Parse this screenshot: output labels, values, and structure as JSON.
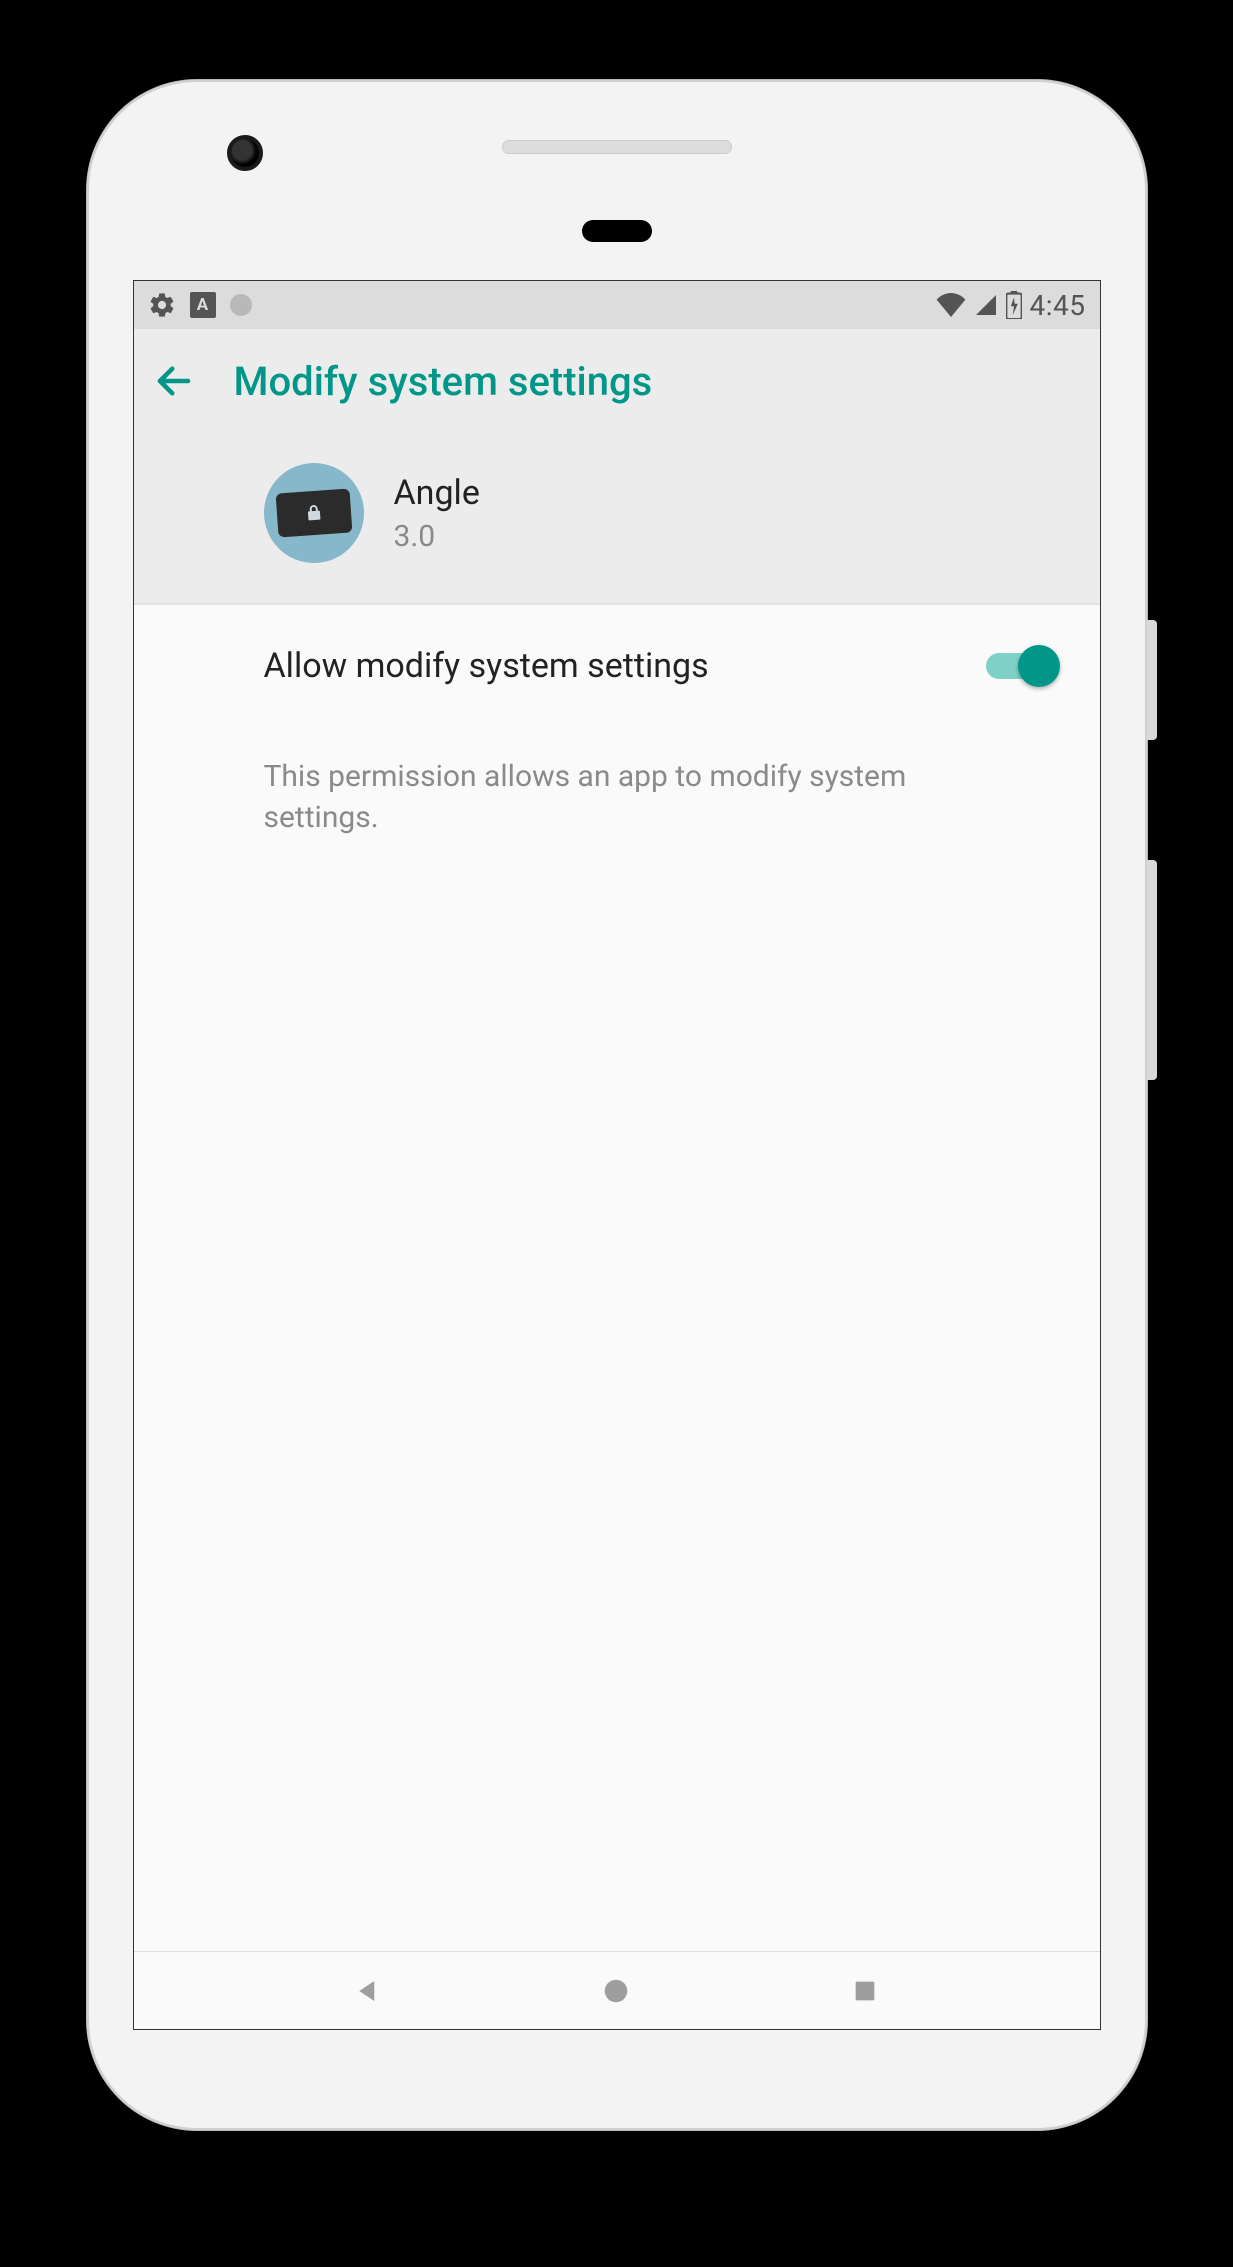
{
  "status_bar": {
    "time": "4:45",
    "left_icons": {
      "settings": "gear-icon",
      "badge_letter": "A",
      "dot": "dot"
    },
    "right_icons": {
      "wifi": "wifi-icon",
      "cell": "cell-icon",
      "battery": "battery-charging-icon"
    }
  },
  "header": {
    "back": "back",
    "title": "Modify system settings"
  },
  "app": {
    "icon": "angle-app-icon",
    "name": "Angle",
    "version": "3.0"
  },
  "setting": {
    "label": "Allow modify system settings",
    "enabled": true,
    "description": "This permission allows an app to modify system settings."
  },
  "nav": {
    "back": "nav-back",
    "home": "nav-home",
    "recents": "nav-recents"
  },
  "colors": {
    "accent": "#009688",
    "status_bg": "#dcdcdc",
    "header_bg": "#ececec",
    "text_secondary": "#8a8a8a"
  }
}
